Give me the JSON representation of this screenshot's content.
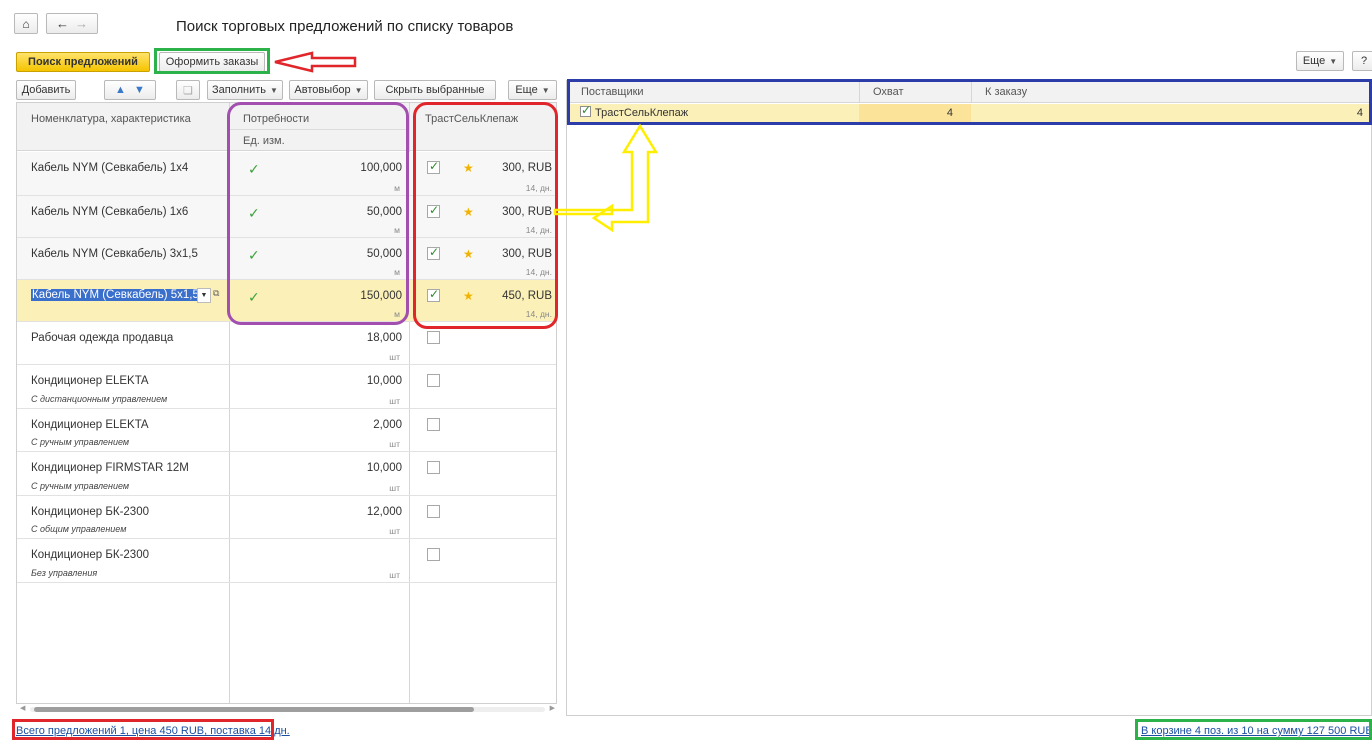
{
  "nav": {
    "home_icon": "home-icon",
    "back_icon": "arrow-left-icon",
    "fwd_icon": "arrow-right-icon"
  },
  "title": "Поиск торговых предложений по списку товаров",
  "toolbar": {
    "search_offers": "Поиск предложений",
    "place_orders": "Оформить заказы",
    "more": "Еще",
    "help": "?"
  },
  "left_toolbar": {
    "add": "Добавить",
    "fill": "Заполнить",
    "autoselect": "Автовыбор",
    "hide_selected": "Скрыть выбранные",
    "more": "Еще"
  },
  "left_table": {
    "headers": {
      "item": "Номенклатура, характеристика",
      "needs": "Потребности",
      "unit": "Ед. изм.",
      "supplier": "ТрастСельКлепаж"
    },
    "rows": [
      {
        "name": "Кабель NYM (Севкабель) 1x4",
        "sub": "",
        "need": "100,000",
        "unit": "м",
        "need_ok": true,
        "checked": true,
        "star": true,
        "price": "300, RUB",
        "days": "14, дн."
      },
      {
        "name": "Кабель NYM (Севкабель) 1x6",
        "sub": "",
        "need": "50,000",
        "unit": "м",
        "need_ok": true,
        "checked": true,
        "star": true,
        "price": "300, RUB",
        "days": "14, дн."
      },
      {
        "name": "Кабель NYM (Севкабель) 3x1,5",
        "sub": "",
        "need": "50,000",
        "unit": "м",
        "need_ok": true,
        "checked": true,
        "star": true,
        "price": "300, RUB",
        "days": "14, дн."
      },
      {
        "name": "Кабель NYM (Севкабель) 5x1,5",
        "sub": "",
        "need": "150,000",
        "unit": "м",
        "need_ok": true,
        "checked": true,
        "star": true,
        "price": "450, RUB",
        "days": "14, дн."
      },
      {
        "name": "Рабочая одежда продавца",
        "sub": "",
        "need": "18,000",
        "unit": "шт",
        "need_ok": false,
        "checked": false,
        "star": false,
        "price": "",
        "days": ""
      },
      {
        "name": "Кондиционер ELEKTA",
        "sub": "С дистанционным управлением",
        "need": "10,000",
        "unit": "шт",
        "need_ok": false,
        "checked": false,
        "star": false,
        "price": "",
        "days": ""
      },
      {
        "name": "Кондиционер ELEKTA",
        "sub": "С ручным управлением",
        "need": "2,000",
        "unit": "шт",
        "need_ok": false,
        "checked": false,
        "star": false,
        "price": "",
        "days": ""
      },
      {
        "name": "Кондиционер FIRMSTAR 12M",
        "sub": "С ручным управлением",
        "need": "10,000",
        "unit": "шт",
        "need_ok": false,
        "checked": false,
        "star": false,
        "price": "",
        "days": ""
      },
      {
        "name": "Кондиционер БК-2300",
        "sub": "С общим управлением",
        "need": "12,000",
        "unit": "шт",
        "need_ok": false,
        "checked": false,
        "star": false,
        "price": "",
        "days": ""
      },
      {
        "name": "Кондиционер БК-2300",
        "sub": "Без управления",
        "need": "",
        "unit": "шт",
        "need_ok": false,
        "checked": false,
        "star": false,
        "price": "",
        "days": ""
      }
    ]
  },
  "right_table": {
    "headers": {
      "suppliers": "Поставщики",
      "coverage": "Охват",
      "to_order": "К заказу"
    },
    "rows": [
      {
        "supplier": "ТрастСельКлепаж",
        "checked": true,
        "coverage": "4",
        "to_order": "4"
      }
    ]
  },
  "footer": {
    "left": "Всего предложений 1, цена 450 RUB, поставка 14 дн.",
    "right": "В корзине 4 поз. из 10 на сумму 127 500 RUB"
  },
  "colors": {
    "highlight_yellow": "#fbf0b8",
    "primary_button": "#f5c400",
    "link": "#1a4ea3"
  }
}
